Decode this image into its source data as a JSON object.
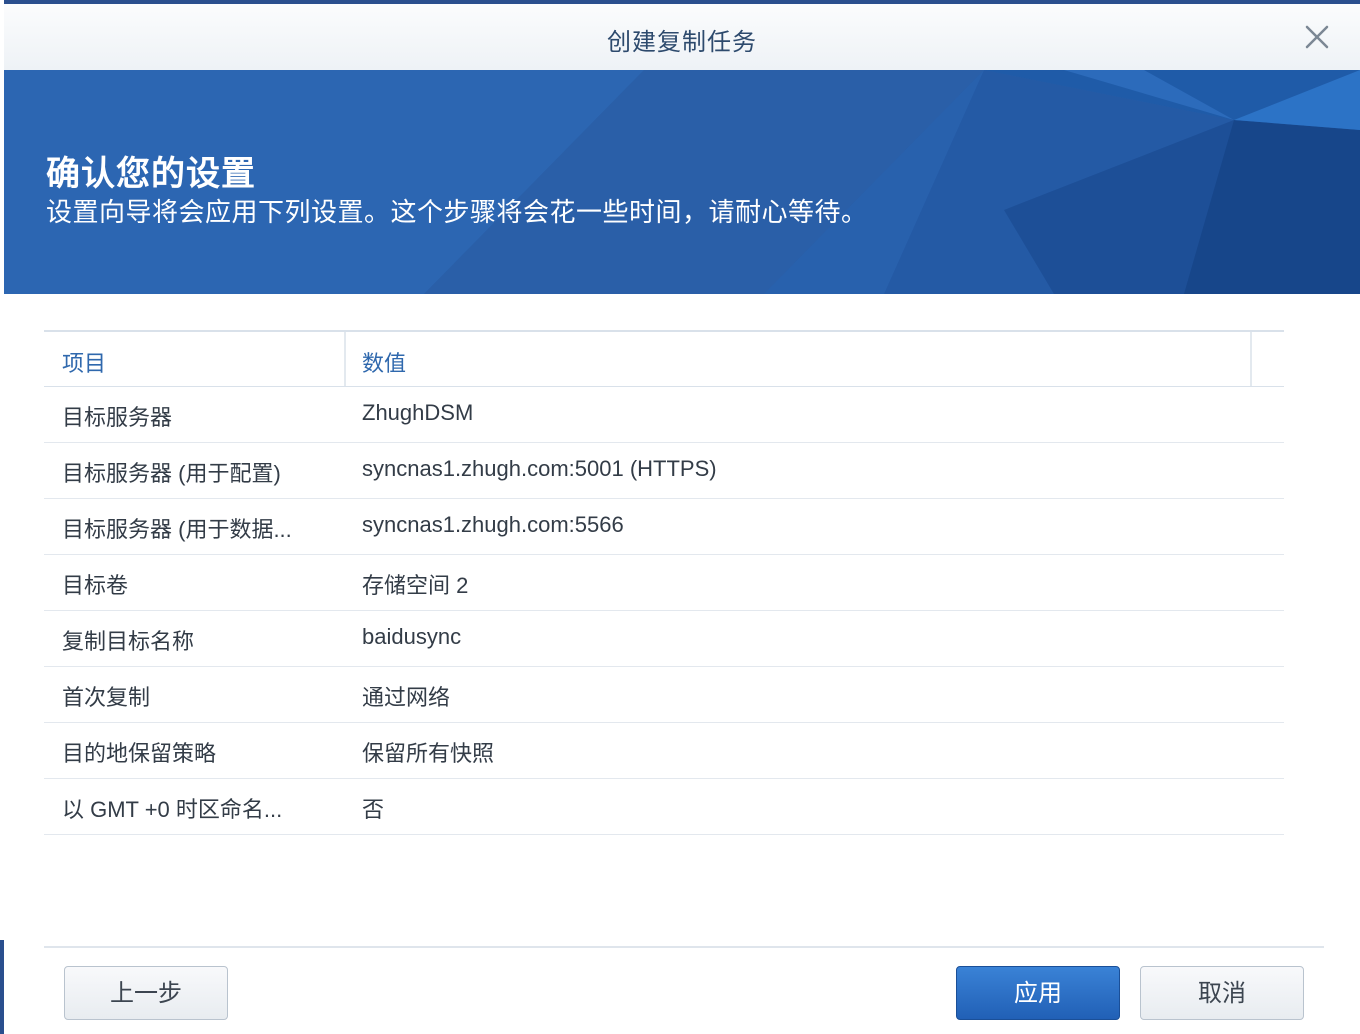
{
  "window": {
    "title": "创建复制任务"
  },
  "banner": {
    "heading": "确认您的设置",
    "subheading": "设置向导将会应用下列设置。这个步骤将会花一些时间，请耐心等待。"
  },
  "grid": {
    "columns": [
      "项目",
      "数值"
    ],
    "rows": [
      {
        "key": "目标服务器",
        "value": "ZhughDSM"
      },
      {
        "key": "目标服务器 (用于配置)",
        "value": "syncnas1.zhugh.com:5001 (HTTPS)"
      },
      {
        "key": "目标服务器 (用于数据...",
        "value": "syncnas1.zhugh.com:5566"
      },
      {
        "key": "目标卷",
        "value": "存储空间 2"
      },
      {
        "key": "复制目标名称",
        "value": "baidusync"
      },
      {
        "key": "首次复制",
        "value": "通过网络"
      },
      {
        "key": "目的地保留策略",
        "value": "保留所有快照"
      },
      {
        "key": "以 GMT +0 时区命名...",
        "value": "否"
      }
    ]
  },
  "footer": {
    "back_label": "上一步",
    "apply_label": "应用",
    "cancel_label": "取消"
  },
  "icons": {
    "close": "close-icon"
  },
  "colors": {
    "banner": "#2a64b0",
    "primary_button": "#2a6fc6",
    "header_text": "#2f68ad"
  }
}
